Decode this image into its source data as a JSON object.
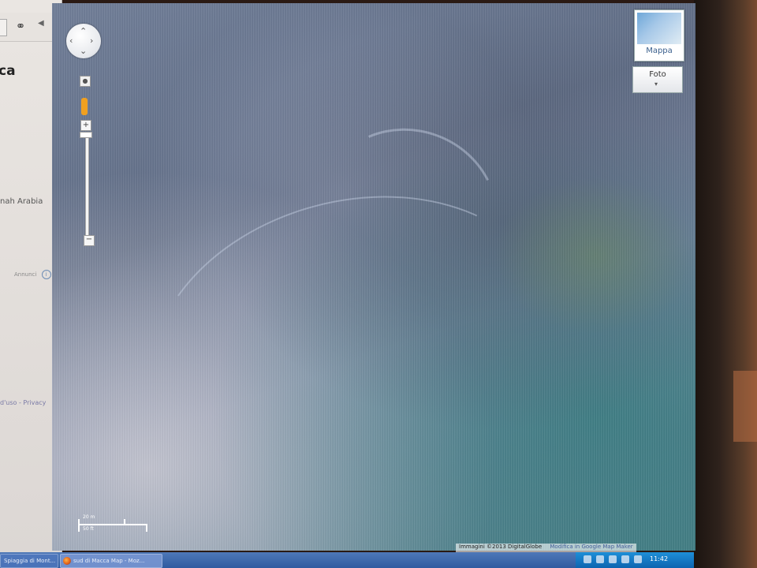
{
  "sidebar": {
    "partial_title": "ca",
    "partial_subtitle": "nah Arabia",
    "footer_partial": "Annunci",
    "terms_partial": "d'uso - Privacy",
    "icons": [
      "link-icon",
      "collapse-arrow-icon",
      "info-icon"
    ]
  },
  "map": {
    "map_type": {
      "map_label": "Mappa",
      "photo_label": "Foto",
      "photo_caret": "▾"
    },
    "zoom": {
      "plus": "+",
      "minus": "−"
    },
    "scale": {
      "top_label": "20 m",
      "bottom_label": "50 ft"
    },
    "attribution": {
      "imagery": "Immagini ©2013 DigitalGlobe",
      "link": "Modifica in Google Map Maker"
    }
  },
  "taskbar": {
    "items": [
      {
        "label": "Spiaggia di Mont..."
      },
      {
        "label": "sud di Macca Map - Moz..."
      }
    ],
    "clock": "11:42"
  }
}
